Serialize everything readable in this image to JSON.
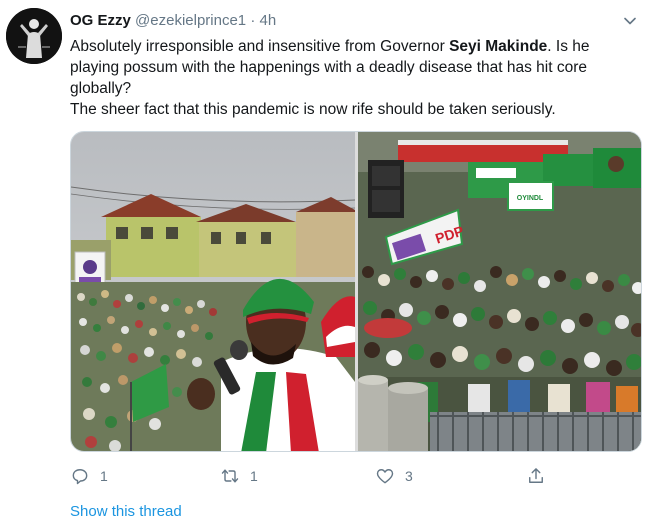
{
  "tweet": {
    "display_name": "OG Ezzy",
    "handle": "@ezekielprince1",
    "separator": "·",
    "time": "4h",
    "menu_icon": "chevron-down-icon",
    "text": {
      "part1": "Absolutely irresponsible and insensitive from Governor ",
      "bold": "Seyi Makinde",
      "part2": ". Is he playing possum with the happenings with a deadly disease that has hit core globally?",
      "line2": "The sheer fact that this pandemic is now rife should be taken seriously."
    },
    "photos": [
      {
        "alt": "photo-rally-speaker-with-microphone"
      },
      {
        "alt": "photo-crowd-with-party-banners"
      }
    ],
    "banner_texts": [
      "PDP",
      "OYINDL"
    ],
    "actions": {
      "reply_count": "1",
      "retweet_count": "1",
      "like_count": "3",
      "share_count": ""
    },
    "show_thread": "Show this thread"
  },
  "colors": {
    "text": "#14171a",
    "secondary": "#657786",
    "link": "#1b95e0",
    "border": "#ccd6dd",
    "party_green": "#1f8a3a",
    "party_red": "#d0202e"
  }
}
